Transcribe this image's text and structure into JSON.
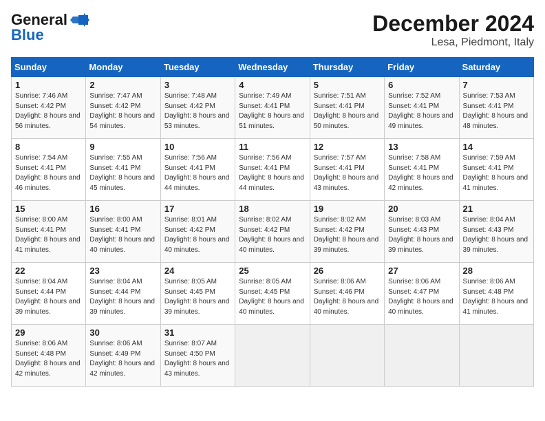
{
  "header": {
    "logo_line1": "General",
    "logo_line2": "Blue",
    "month": "December 2024",
    "location": "Lesa, Piedmont, Italy"
  },
  "weekdays": [
    "Sunday",
    "Monday",
    "Tuesday",
    "Wednesday",
    "Thursday",
    "Friday",
    "Saturday"
  ],
  "weeks": [
    [
      {
        "num": "1",
        "sunrise": "7:46 AM",
        "sunset": "4:42 PM",
        "daylight": "8 hours and 56 minutes."
      },
      {
        "num": "2",
        "sunrise": "7:47 AM",
        "sunset": "4:42 PM",
        "daylight": "8 hours and 54 minutes."
      },
      {
        "num": "3",
        "sunrise": "7:48 AM",
        "sunset": "4:42 PM",
        "daylight": "8 hours and 53 minutes."
      },
      {
        "num": "4",
        "sunrise": "7:49 AM",
        "sunset": "4:41 PM",
        "daylight": "8 hours and 51 minutes."
      },
      {
        "num": "5",
        "sunrise": "7:51 AM",
        "sunset": "4:41 PM",
        "daylight": "8 hours and 50 minutes."
      },
      {
        "num": "6",
        "sunrise": "7:52 AM",
        "sunset": "4:41 PM",
        "daylight": "8 hours and 49 minutes."
      },
      {
        "num": "7",
        "sunrise": "7:53 AM",
        "sunset": "4:41 PM",
        "daylight": "8 hours and 48 minutes."
      }
    ],
    [
      {
        "num": "8",
        "sunrise": "7:54 AM",
        "sunset": "4:41 PM",
        "daylight": "8 hours and 46 minutes."
      },
      {
        "num": "9",
        "sunrise": "7:55 AM",
        "sunset": "4:41 PM",
        "daylight": "8 hours and 45 minutes."
      },
      {
        "num": "10",
        "sunrise": "7:56 AM",
        "sunset": "4:41 PM",
        "daylight": "8 hours and 44 minutes."
      },
      {
        "num": "11",
        "sunrise": "7:56 AM",
        "sunset": "4:41 PM",
        "daylight": "8 hours and 44 minutes."
      },
      {
        "num": "12",
        "sunrise": "7:57 AM",
        "sunset": "4:41 PM",
        "daylight": "8 hours and 43 minutes."
      },
      {
        "num": "13",
        "sunrise": "7:58 AM",
        "sunset": "4:41 PM",
        "daylight": "8 hours and 42 minutes."
      },
      {
        "num": "14",
        "sunrise": "7:59 AM",
        "sunset": "4:41 PM",
        "daylight": "8 hours and 41 minutes."
      }
    ],
    [
      {
        "num": "15",
        "sunrise": "8:00 AM",
        "sunset": "4:41 PM",
        "daylight": "8 hours and 41 minutes."
      },
      {
        "num": "16",
        "sunrise": "8:00 AM",
        "sunset": "4:41 PM",
        "daylight": "8 hours and 40 minutes."
      },
      {
        "num": "17",
        "sunrise": "8:01 AM",
        "sunset": "4:42 PM",
        "daylight": "8 hours and 40 minutes."
      },
      {
        "num": "18",
        "sunrise": "8:02 AM",
        "sunset": "4:42 PM",
        "daylight": "8 hours and 40 minutes."
      },
      {
        "num": "19",
        "sunrise": "8:02 AM",
        "sunset": "4:42 PM",
        "daylight": "8 hours and 39 minutes."
      },
      {
        "num": "20",
        "sunrise": "8:03 AM",
        "sunset": "4:43 PM",
        "daylight": "8 hours and 39 minutes."
      },
      {
        "num": "21",
        "sunrise": "8:04 AM",
        "sunset": "4:43 PM",
        "daylight": "8 hours and 39 minutes."
      }
    ],
    [
      {
        "num": "22",
        "sunrise": "8:04 AM",
        "sunset": "4:44 PM",
        "daylight": "8 hours and 39 minutes."
      },
      {
        "num": "23",
        "sunrise": "8:04 AM",
        "sunset": "4:44 PM",
        "daylight": "8 hours and 39 minutes."
      },
      {
        "num": "24",
        "sunrise": "8:05 AM",
        "sunset": "4:45 PM",
        "daylight": "8 hours and 39 minutes."
      },
      {
        "num": "25",
        "sunrise": "8:05 AM",
        "sunset": "4:45 PM",
        "daylight": "8 hours and 40 minutes."
      },
      {
        "num": "26",
        "sunrise": "8:06 AM",
        "sunset": "4:46 PM",
        "daylight": "8 hours and 40 minutes."
      },
      {
        "num": "27",
        "sunrise": "8:06 AM",
        "sunset": "4:47 PM",
        "daylight": "8 hours and 40 minutes."
      },
      {
        "num": "28",
        "sunrise": "8:06 AM",
        "sunset": "4:48 PM",
        "daylight": "8 hours and 41 minutes."
      }
    ],
    [
      {
        "num": "29",
        "sunrise": "8:06 AM",
        "sunset": "4:48 PM",
        "daylight": "8 hours and 42 minutes."
      },
      {
        "num": "30",
        "sunrise": "8:06 AM",
        "sunset": "4:49 PM",
        "daylight": "8 hours and 42 minutes."
      },
      {
        "num": "31",
        "sunrise": "8:07 AM",
        "sunset": "4:50 PM",
        "daylight": "8 hours and 43 minutes."
      },
      null,
      null,
      null,
      null
    ]
  ]
}
